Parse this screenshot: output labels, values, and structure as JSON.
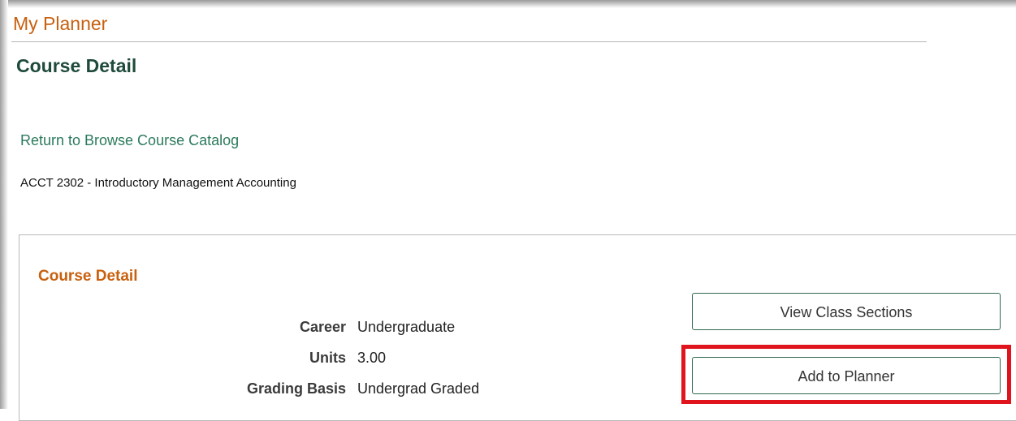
{
  "header": {
    "title": "My Planner"
  },
  "page": {
    "title": "Course Detail",
    "return_link": "Return to Browse Course Catalog",
    "course_name": "ACCT 2302 - Introductory Management Accounting"
  },
  "detail": {
    "heading": "Course Detail",
    "fields": [
      {
        "label": "Career",
        "value": "Undergraduate"
      },
      {
        "label": "Units",
        "value": "3.00"
      },
      {
        "label": "Grading Basis",
        "value": "Undergrad Graded"
      }
    ]
  },
  "actions": {
    "view_sections": "View Class Sections",
    "add_to_planner": "Add to Planner"
  },
  "colors": {
    "header_orange": "#c8600e",
    "title_green": "#1e4b3a",
    "link_green": "#2c7a5c",
    "highlight_red": "#e0141c"
  }
}
